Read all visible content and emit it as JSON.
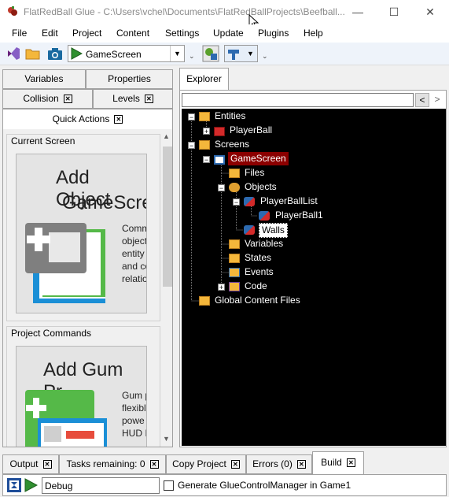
{
  "window": {
    "title": "FlatRedBall Glue - C:\\Users\\vchel\\Documents\\FlatRedBallProjects\\Beefball...",
    "minimize": "—",
    "maximize": "☐",
    "close": "✕"
  },
  "menu": [
    "File",
    "Edit",
    "Project",
    "Content",
    "Settings",
    "Update",
    "Plugins",
    "Help"
  ],
  "toolbar": {
    "screen_select": "GameScreen"
  },
  "left_tabs": {
    "variables": "Variables",
    "properties": "Properties",
    "collision": "Collision",
    "levels": "Levels",
    "quick_actions": "Quick Actions"
  },
  "quick_actions": {
    "current_screen_header": "Current Screen",
    "card1_title_line1": "Add Object",
    "card1_title_line2": "GameScre",
    "card1_text": [
      "Comm",
      "object",
      "entity",
      "and co",
      "relatio"
    ],
    "project_commands_header": "Project Commands",
    "card2_title": "Add Gum Pr",
    "card2_text": [
      "Gum p",
      "flexibl",
      "powe",
      "HUD I"
    ]
  },
  "explorer": {
    "tab": "Explorer",
    "search_value": "",
    "nav_back": "<",
    "nav_forward": ">",
    "tree": {
      "entities": "Entities",
      "playerball": "PlayerBall",
      "screens": "Screens",
      "gamescreen": "GameScreen",
      "files": "Files",
      "objects": "Objects",
      "playerballlist": "PlayerBallList",
      "playerball1": "PlayerBall1",
      "walls": "Walls",
      "variables": "Variables",
      "states": "States",
      "events": "Events",
      "code": "Code",
      "global_content": "Global Content Files"
    }
  },
  "bottom_tabs": {
    "output": "Output",
    "tasks": "Tasks remaining: 0",
    "copy_project": "Copy Project",
    "errors": "Errors (0)",
    "build": "Build"
  },
  "build_bar": {
    "configuration": "Debug",
    "generate_label": "Generate GlueControlManager in Game1"
  },
  "colors": {
    "tree_bg": "#000000",
    "selected_bg": "#8b0000",
    "toolbar_bg": "#eef3fa"
  }
}
